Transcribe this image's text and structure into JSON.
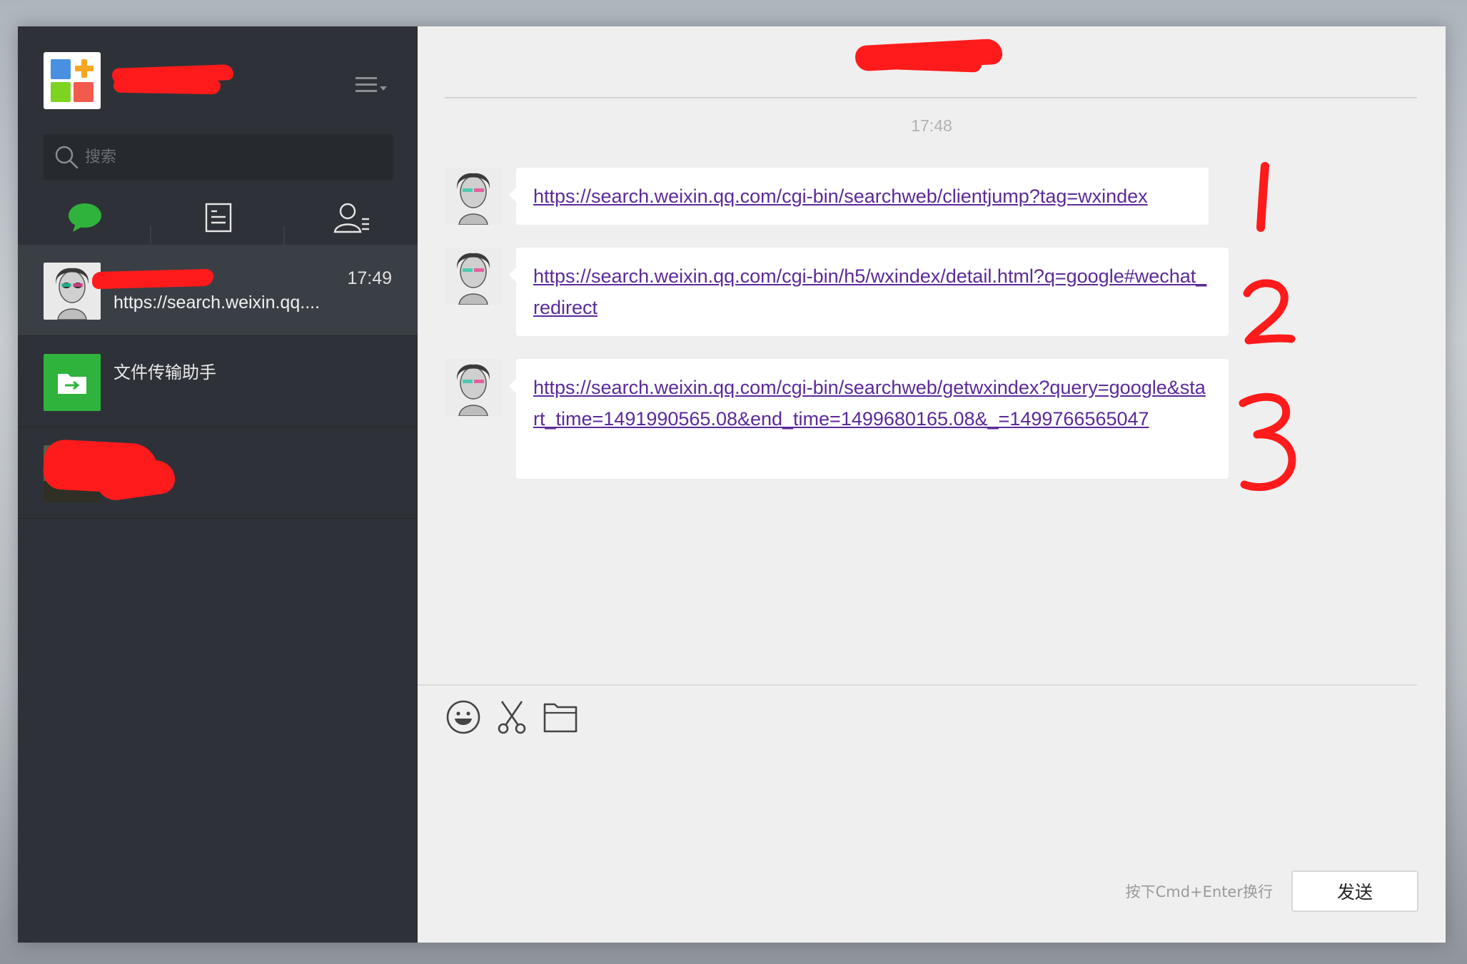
{
  "search": {
    "placeholder": "搜索"
  },
  "chats": [
    {
      "name": "",
      "time": "17:49",
      "preview": "https://search.weixin.qq...."
    },
    {
      "name": "文件传输助手",
      "time": "",
      "preview": ""
    },
    {
      "name": "​​​​​​​​~",
      "time": "",
      "preview": ""
    }
  ],
  "conversation": {
    "timestamp": "17:48",
    "messages": [
      {
        "url": "https://search.weixin.qq.com/cgi-bin/searchweb/clientjump?tag=wxindex"
      },
      {
        "url": "https://search.weixin.qq.com/cgi-bin/h5/wxindex/detail.html?q=google#wechat_redirect"
      },
      {
        "url": "https://search.weixin.qq.com/cgi-bin/searchweb/getwxindex?query=google&start_time=1491990565.08&end_time=1499680165.08&_=1499766565047"
      }
    ]
  },
  "composer": {
    "hint": "按下Cmd+Enter换行",
    "send_label": "发送"
  },
  "icons": {
    "chat_tab": "chat-bubble-icon",
    "articles_tab": "article-icon",
    "contacts_tab": "contacts-icon",
    "menu": "hamburger-menu-icon",
    "search": "search-icon",
    "emoji": "emoji-icon",
    "screenshot": "scissors-icon",
    "file": "folder-icon"
  },
  "colors": {
    "sidebar": "#2e3238",
    "accent_green": "#2fb33c",
    "link": "#5b2a99",
    "annotation_red": "#ff1b1b"
  }
}
